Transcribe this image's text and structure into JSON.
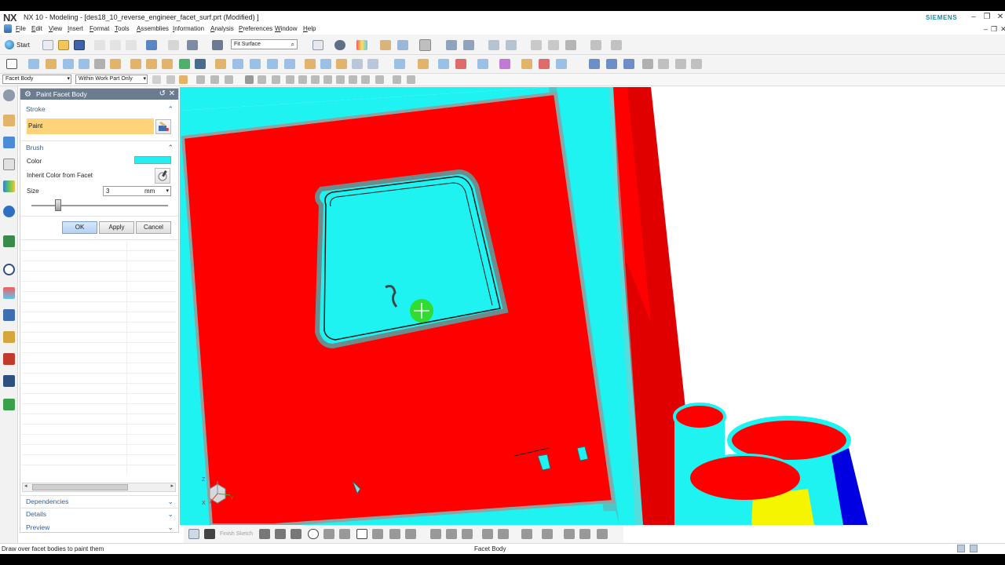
{
  "window": {
    "logo": "NX",
    "title": "NX 10 - Modeling - [des18_10_reverse_engineer_facet_surf.prt (Modified) ]",
    "brand": "SIEMENS",
    "controls": [
      "–",
      "❐",
      "✕"
    ]
  },
  "menu": {
    "items": [
      "File",
      "Edit",
      "View",
      "Insert",
      "Format",
      "Tools",
      "Assemblies",
      "Information",
      "Analysis",
      "Preferences",
      "Window",
      "Help"
    ],
    "controls": [
      "–",
      "❐",
      "✕"
    ]
  },
  "toolbar": {
    "start_label": "Start",
    "fit_surface": "Fit Surface",
    "selection_filter": "Facet Body",
    "selection_scope": "Within Work Part Only"
  },
  "dialog": {
    "title": "Paint Facet Body",
    "stroke_section": "Stroke",
    "paint_label": "Paint",
    "brush_section": "Brush",
    "color_label": "Color",
    "color_value": "#22f0f0",
    "inherit_label": "Inherit Color from Facet",
    "size_label": "Size",
    "size_value": "3",
    "size_unit": "mm",
    "ok": "OK",
    "apply": "Apply",
    "cancel": "Cancel",
    "dependencies": "Dependencies",
    "details": "Details",
    "preview": "Preview"
  },
  "sketch": {
    "finish_sketch": "Finish Sketch"
  },
  "status": {
    "left": "Draw over facet bodies to paint them",
    "center": "Facet Body"
  },
  "viewport": {
    "colors": {
      "red": "#ff0000",
      "cyan": "#1ff3f2",
      "dark_red": "#8b0000",
      "blue": "#0000e0",
      "yellow": "#f5f500",
      "brush_cursor": "#2fdc2f"
    },
    "triad_labels": [
      "Z",
      "X",
      "Y"
    ]
  }
}
